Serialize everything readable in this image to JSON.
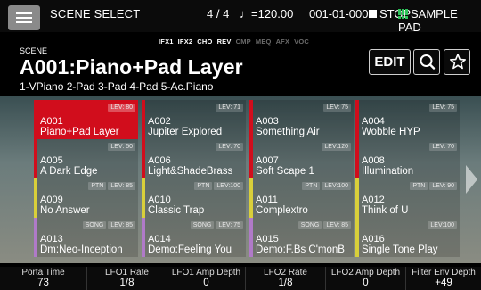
{
  "topbar": {
    "title": "SCENE SELECT",
    "meter": "4 / 4",
    "tempo": "♩=120.00",
    "position": "001-01-000",
    "stop_label": "STOP",
    "pad_label": "SAMPLE PAD"
  },
  "fx": [
    {
      "label": "IFX1",
      "active": true
    },
    {
      "label": "IFX2",
      "active": true
    },
    {
      "label": "CHO",
      "active": true
    },
    {
      "label": "REV",
      "active": true
    },
    {
      "label": "CMP",
      "active": false
    },
    {
      "label": "MEQ",
      "active": false
    },
    {
      "label": "AFX",
      "active": false
    },
    {
      "label": "VOC",
      "active": false
    }
  ],
  "scene": {
    "label": "SCENE",
    "name": "A001:Piano+Pad Layer",
    "parts": "1-VPiano 2-Pad 3-Pad 4-Pad 5-Ac.Piano",
    "edit_label": "EDIT"
  },
  "accent_colors": {
    "red": "#d10d1c",
    "yellow": "#d9cf3a",
    "purple": "#b07ac8",
    "green_grid": "#2ec45a"
  },
  "tiles": [
    {
      "num": "A001",
      "name": "Piano+Pad Layer",
      "tags": [
        "LEV: 80"
      ],
      "accent": "red",
      "selected": true
    },
    {
      "num": "A002",
      "name": "Jupiter Explored",
      "tags": [
        "LEV: 71"
      ],
      "accent": "red",
      "selected": false
    },
    {
      "num": "A003",
      "name": "Something Air",
      "tags": [
        "LEV: 75"
      ],
      "accent": "red",
      "selected": false
    },
    {
      "num": "A004",
      "name": "Wobble HYP",
      "tags": [
        "LEV: 75"
      ],
      "accent": "red",
      "selected": false
    },
    {
      "num": "A005",
      "name": "A Dark Edge",
      "tags": [
        "LEV: 50"
      ],
      "accent": "red",
      "selected": false
    },
    {
      "num": "A006",
      "name": "Light&ShadeBrass",
      "tags": [
        "LEV: 70"
      ],
      "accent": "red",
      "selected": false
    },
    {
      "num": "A007",
      "name": "Soft Scape 1",
      "tags": [
        "LEV:120"
      ],
      "accent": "red",
      "selected": false
    },
    {
      "num": "A008",
      "name": "Illumination",
      "tags": [
        "LEV: 70"
      ],
      "accent": "red",
      "selected": false
    },
    {
      "num": "A009",
      "name": "No Answer",
      "tags": [
        "PTN",
        "LEV: 85"
      ],
      "accent": "yellow",
      "selected": false
    },
    {
      "num": "A010",
      "name": "Classic Trap",
      "tags": [
        "PTN",
        "LEV:100"
      ],
      "accent": "yellow",
      "selected": false
    },
    {
      "num": "A011",
      "name": "Complextro",
      "tags": [
        "PTN",
        "LEV:100"
      ],
      "accent": "yellow",
      "selected": false
    },
    {
      "num": "A012",
      "name": "Think of U",
      "tags": [
        "PTN",
        "LEV: 90"
      ],
      "accent": "yellow",
      "selected": false
    },
    {
      "num": "A013",
      "name": "Dm:Neo-Inception",
      "tags": [
        "SONG",
        "LEV: 85"
      ],
      "accent": "purple",
      "selected": false
    },
    {
      "num": "A014",
      "name": "Demo:Feeling You",
      "tags": [
        "SONG",
        "LEV: 75"
      ],
      "accent": "purple",
      "selected": false
    },
    {
      "num": "A015",
      "name": "Demo:F.Bs C'monB",
      "tags": [
        "SONG",
        "LEV: 85"
      ],
      "accent": "purple",
      "selected": false
    },
    {
      "num": "A016",
      "name": "Single Tone Play",
      "tags": [
        "LEV:100"
      ],
      "accent": "yellow",
      "selected": false
    }
  ],
  "knobs": [
    {
      "label": "Porta Time",
      "value": "73"
    },
    {
      "label": "LFO1 Rate",
      "value": "1/8"
    },
    {
      "label": "LFO1 Amp Depth",
      "value": "0"
    },
    {
      "label": "LFO2 Rate",
      "value": "1/8"
    },
    {
      "label": "LFO2 Amp Depth",
      "value": "0"
    },
    {
      "label": "Filter Env Depth",
      "value": "+49"
    }
  ]
}
